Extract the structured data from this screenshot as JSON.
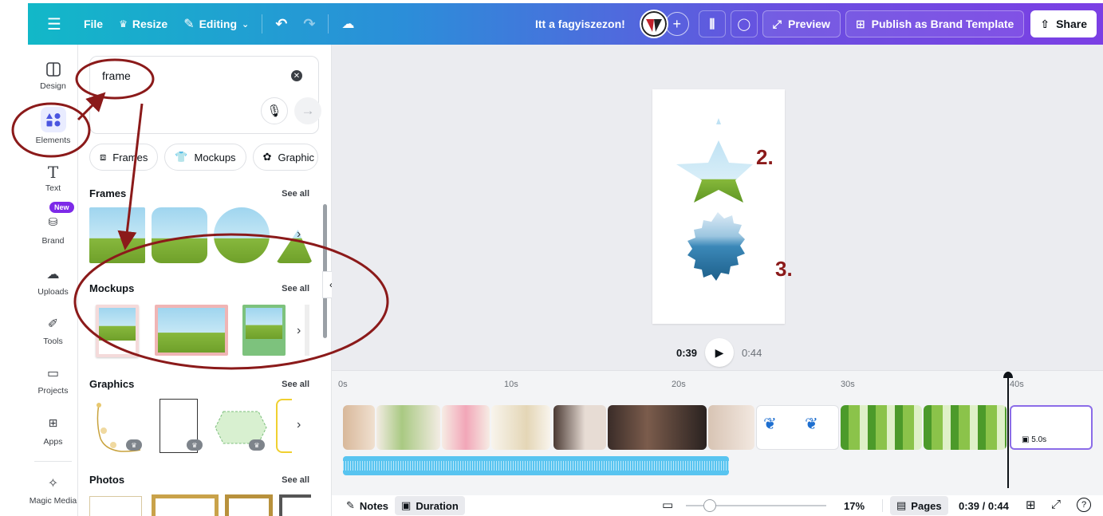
{
  "topbar": {
    "file_label": "File",
    "resize_label": "Resize",
    "editing_label": "Editing",
    "design_title": "Itt a fagyiszezon!",
    "preview_label": "Preview",
    "publish_label": "Publish as Brand Template",
    "share_label": "Share"
  },
  "rail": {
    "items": [
      {
        "label": "Design"
      },
      {
        "label": "Elements"
      },
      {
        "label": "Text"
      },
      {
        "label": "Brand"
      },
      {
        "label": "Uploads"
      },
      {
        "label": "Tools"
      },
      {
        "label": "Projects"
      },
      {
        "label": "Apps"
      },
      {
        "label": "Magic Media"
      }
    ],
    "new_badge": "New"
  },
  "panel": {
    "search_value": "frame",
    "chips": [
      "Frames",
      "Mockups",
      "Graphic"
    ],
    "sections": [
      {
        "title": "Frames",
        "see_all": "See all"
      },
      {
        "title": "Mockups",
        "see_all": "See all"
      },
      {
        "title": "Graphics",
        "see_all": "See all"
      },
      {
        "title": "Photos",
        "see_all": "See all"
      }
    ]
  },
  "canvas": {
    "time_current": "0:39",
    "time_total": "0:44",
    "annotations": [
      "2.",
      "3."
    ]
  },
  "timeline": {
    "ticks": [
      "0s",
      "10s",
      "20s",
      "30s",
      "40s"
    ],
    "last_clip_duration": "5.0s"
  },
  "bottombar": {
    "notes_label": "Notes",
    "duration_label": "Duration",
    "zoom": "17%",
    "pages_label": "Pages",
    "time_readout": "0:39 / 0:44"
  },
  "colors": {
    "annotation_red": "#8b1a1a",
    "accent_purple": "#7d2ae8"
  }
}
